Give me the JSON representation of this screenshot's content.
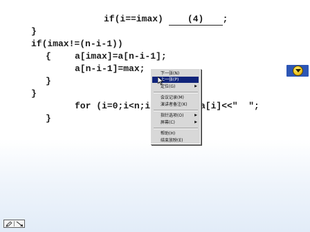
{
  "code": {
    "line1_pre": "if(i==imax) ",
    "line1_blank": "(4)",
    "line1_post": ";",
    "line2": "}",
    "line3": "if(imax!=(n-i-1))",
    "line4": "{",
    "line4b": "a[imax]=a[n-i-1];",
    "line5": "a[n-i-1]=max;",
    "line6": "}",
    "line7": "}",
    "line8_pre": "for (i=0;i<n;i",
    "line8_post": "a[i]<<\"  \";",
    "line9": "}"
  },
  "context_menu": {
    "items": [
      {
        "label": "下一张(N)",
        "has_submenu": false,
        "selected": false
      },
      {
        "label": "上一张(P)",
        "has_submenu": false,
        "selected": true
      },
      {
        "label": "定位(G)",
        "has_submenu": true,
        "selected": false
      },
      {
        "label": "会议记录(M)",
        "has_submenu": false,
        "selected": false
      },
      {
        "label": "演讲者备注(K)",
        "has_submenu": false,
        "selected": false
      },
      {
        "label": "指针选项(O)",
        "has_submenu": true,
        "selected": false
      },
      {
        "label": "屏幕(C)",
        "has_submenu": true,
        "selected": false
      },
      {
        "label": "帮助(H)",
        "has_submenu": false,
        "selected": false
      },
      {
        "label": "结束放映(E)",
        "has_submenu": false,
        "selected": false
      }
    ]
  },
  "icons": {
    "nav_button": "action-button-icon",
    "pen": "pen-icon",
    "arrow": "arrow-icon",
    "cursor": "mouse-pointer-icon"
  },
  "colors": {
    "menu_selected": "#10247a",
    "nav_button_bg": "#2d56b5",
    "nav_button_fg": "#f2c81e"
  }
}
